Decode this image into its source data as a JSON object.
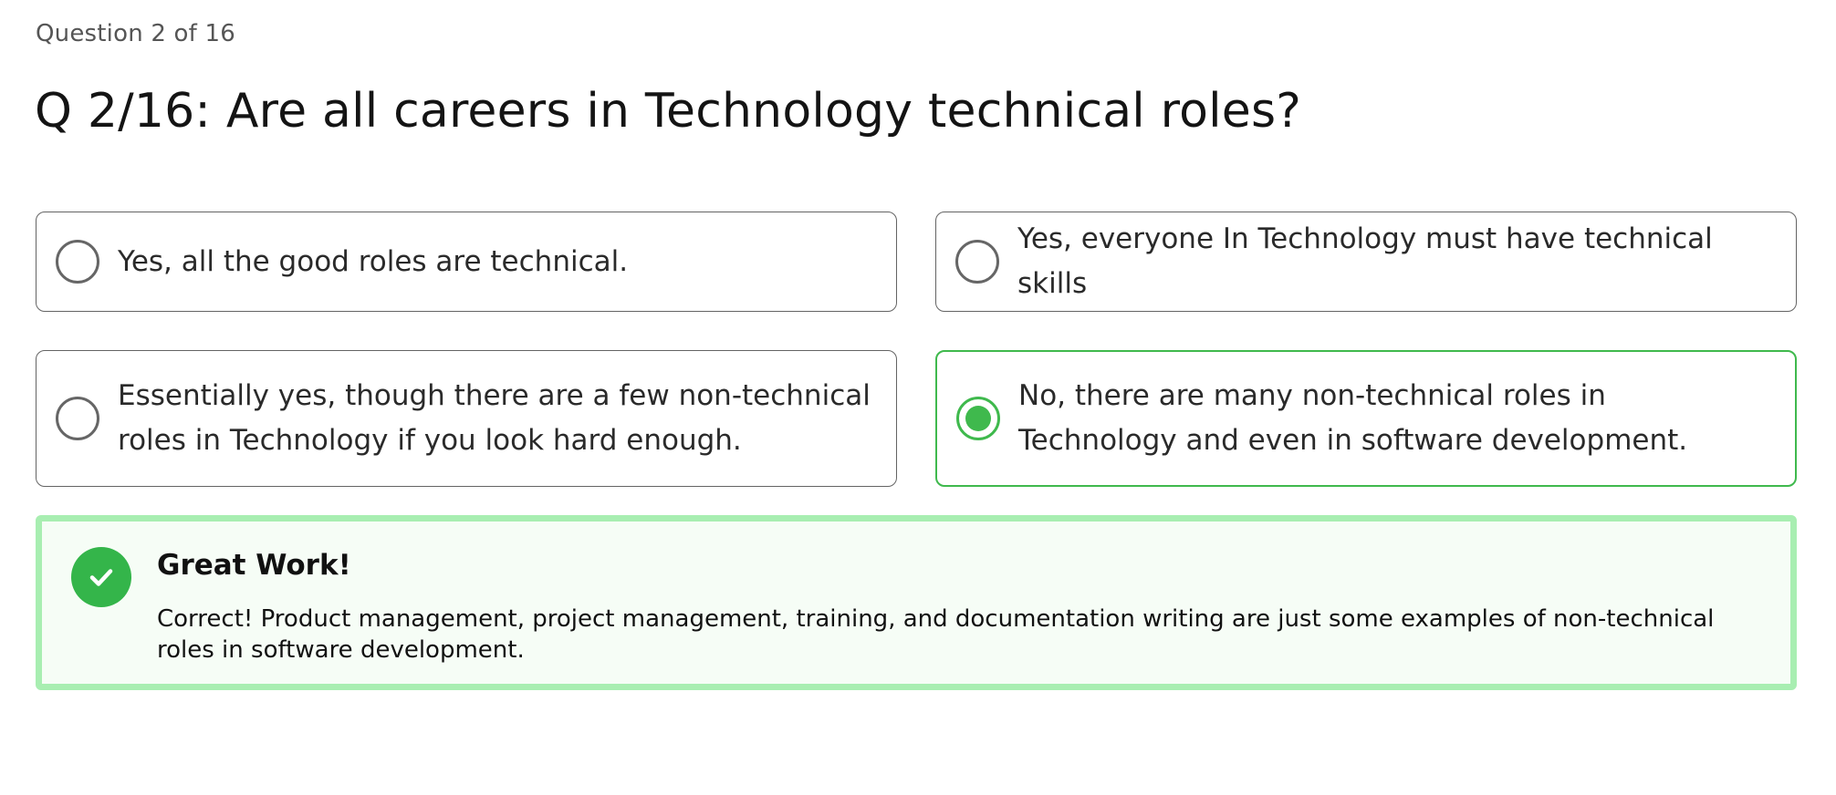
{
  "quiz": {
    "progress_label": "Question 2 of 16",
    "question": "Q 2/16: Are all careers in Technology technical roles?",
    "options": [
      {
        "label": "Yes, all the good roles are technical.",
        "selected": false
      },
      {
        "label": "Yes, everyone In Technology must have technical skills",
        "selected": false
      },
      {
        "label": "Essentially yes, though there are a few non-technical roles in Technology if you look hard enough.",
        "selected": false
      },
      {
        "label": "No, there are many non-technical roles in Technology and even in software development.",
        "selected": true
      }
    ]
  },
  "feedback": {
    "status": "correct",
    "icon": "checkmark-icon",
    "title": "Great Work!",
    "message": "Correct! Product management, project management, training, and documentation writing are just some examples of non-technical roles in software development."
  },
  "colors": {
    "accent_green": "#3fb94d",
    "feedback_border": "#a8eeb1",
    "feedback_background": "#f6fdf6",
    "option_border": "#646464"
  }
}
